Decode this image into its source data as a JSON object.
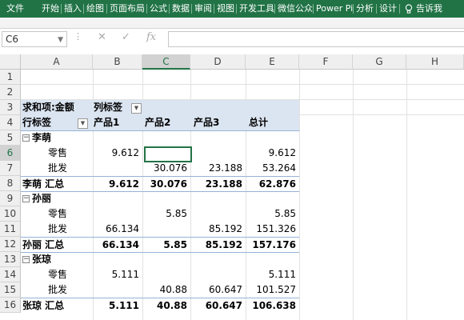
{
  "ribbon": {
    "tabs": [
      "文件",
      "开始",
      "插入",
      "绘图",
      "页面布局",
      "公式",
      "数据",
      "审阅",
      "视图",
      "开发工具",
      "微信公众",
      "Power Pi",
      "分析",
      "设计"
    ],
    "tell_me": "告诉我"
  },
  "formula_bar": {
    "name_box": "C6",
    "formula": ""
  },
  "columns": [
    "A",
    "B",
    "C",
    "D",
    "E",
    "F",
    "G",
    "H"
  ],
  "rows": [
    "1",
    "2",
    "3",
    "4",
    "5",
    "6",
    "7",
    "8",
    "9",
    "10",
    "11",
    "12",
    "13",
    "14",
    "15",
    "16"
  ],
  "pivot": {
    "sum_label": "求和项:金额",
    "col_label": "列标签",
    "row_label": "行标签",
    "col_headers": [
      "产品1",
      "产品2",
      "产品3",
      "总计"
    ],
    "groups": [
      {
        "name": "李萌",
        "rows": [
          {
            "label": "零售",
            "values": [
              "9.612",
              "",
              "",
              "9.612"
            ]
          },
          {
            "label": "批发",
            "values": [
              "",
              "30.076",
              "23.188",
              "53.264"
            ]
          }
        ],
        "total_label": "李萌 汇总",
        "total": [
          "9.612",
          "30.076",
          "23.188",
          "62.876"
        ]
      },
      {
        "name": "孙丽",
        "rows": [
          {
            "label": "零售",
            "values": [
              "",
              "5.85",
              "",
              "5.85"
            ]
          },
          {
            "label": "批发",
            "values": [
              "66.134",
              "",
              "85.192",
              "151.326"
            ]
          }
        ],
        "total_label": "孙丽 汇总",
        "total": [
          "66.134",
          "5.85",
          "85.192",
          "157.176"
        ]
      },
      {
        "name": "张琼",
        "rows": [
          {
            "label": "零售",
            "values": [
              "5.111",
              "",
              "",
              "5.111"
            ]
          },
          {
            "label": "批发",
            "values": [
              "",
              "40.88",
              "60.647",
              "101.527"
            ]
          }
        ],
        "total_label": "张琼 汇总",
        "total": [
          "5.111",
          "40.88",
          "60.647",
          "106.638"
        ]
      }
    ]
  },
  "colors": {
    "ribbon": "#217346",
    "header_band": "#dbe5f1",
    "selection": "#217346"
  }
}
